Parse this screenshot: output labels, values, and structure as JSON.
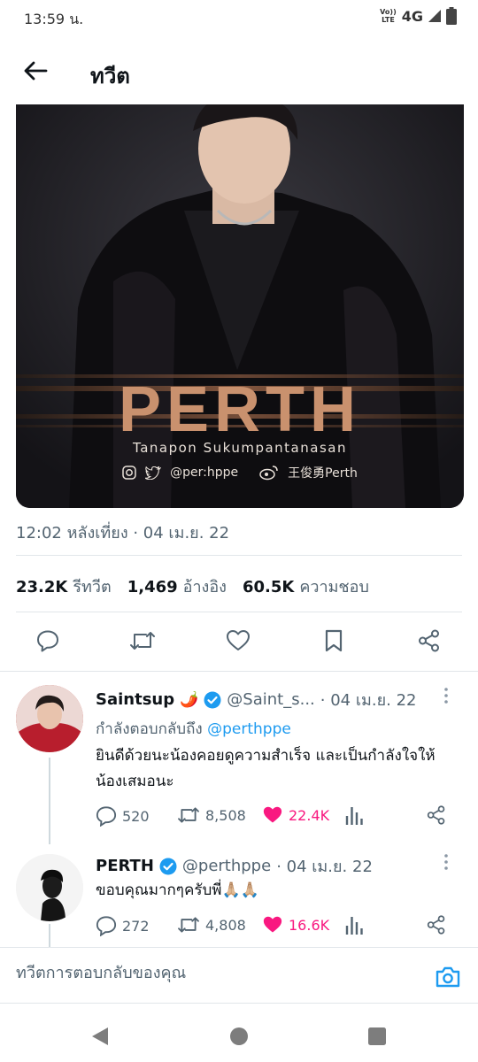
{
  "status_bar": {
    "time": "13:59 น.",
    "volte_top": "Vo))",
    "volte_bottom": "LTE",
    "network": "4G"
  },
  "header": {
    "title": "ทวีต"
  },
  "media": {
    "name": "PERTH",
    "subtitle": "Tanapon Sukumpantanasan",
    "social_handle": "@per:hppe",
    "weibo_handle": "王俊勇Perth"
  },
  "tweet": {
    "timestamp": "12:02 หลังเที่ยง · 04 เม.ย. 22",
    "stats": [
      {
        "value": "23.2K",
        "label": "รีทวีต"
      },
      {
        "value": "1,469",
        "label": "อ้างอิง"
      },
      {
        "value": "60.5K",
        "label": "ความชอบ"
      }
    ]
  },
  "replies": [
    {
      "name": "Saintsup",
      "emoji": "🌶️",
      "handle": "@Saint_s...",
      "date": "· 04 เม.ย. 22",
      "replying_prefix": "กำลังตอบกลับถึง",
      "replying_to": "@perthppe",
      "text": "ยินดีด้วยนะน้องคอยดูความสำเร็จ และเป็นกำลังใจให้น้องเสมอนะ",
      "replies": "520",
      "retweets": "8,508",
      "likes": "22.4K"
    },
    {
      "name": "PERTH",
      "handle": "@perthppe",
      "date": "· 04 เม.ย. 22",
      "text": "ขอบคุณมากๆครับพี่🙏🏼🙏🏼",
      "replies": "272",
      "retweets": "4,808",
      "likes": "16.6K"
    }
  ],
  "composer": {
    "placeholder": "ทวีตการตอบกลับของคุณ"
  },
  "colors": {
    "accent": "#1d9bf0",
    "like": "#f91880",
    "muted": "#536471",
    "divider": "#e1e6ea"
  }
}
